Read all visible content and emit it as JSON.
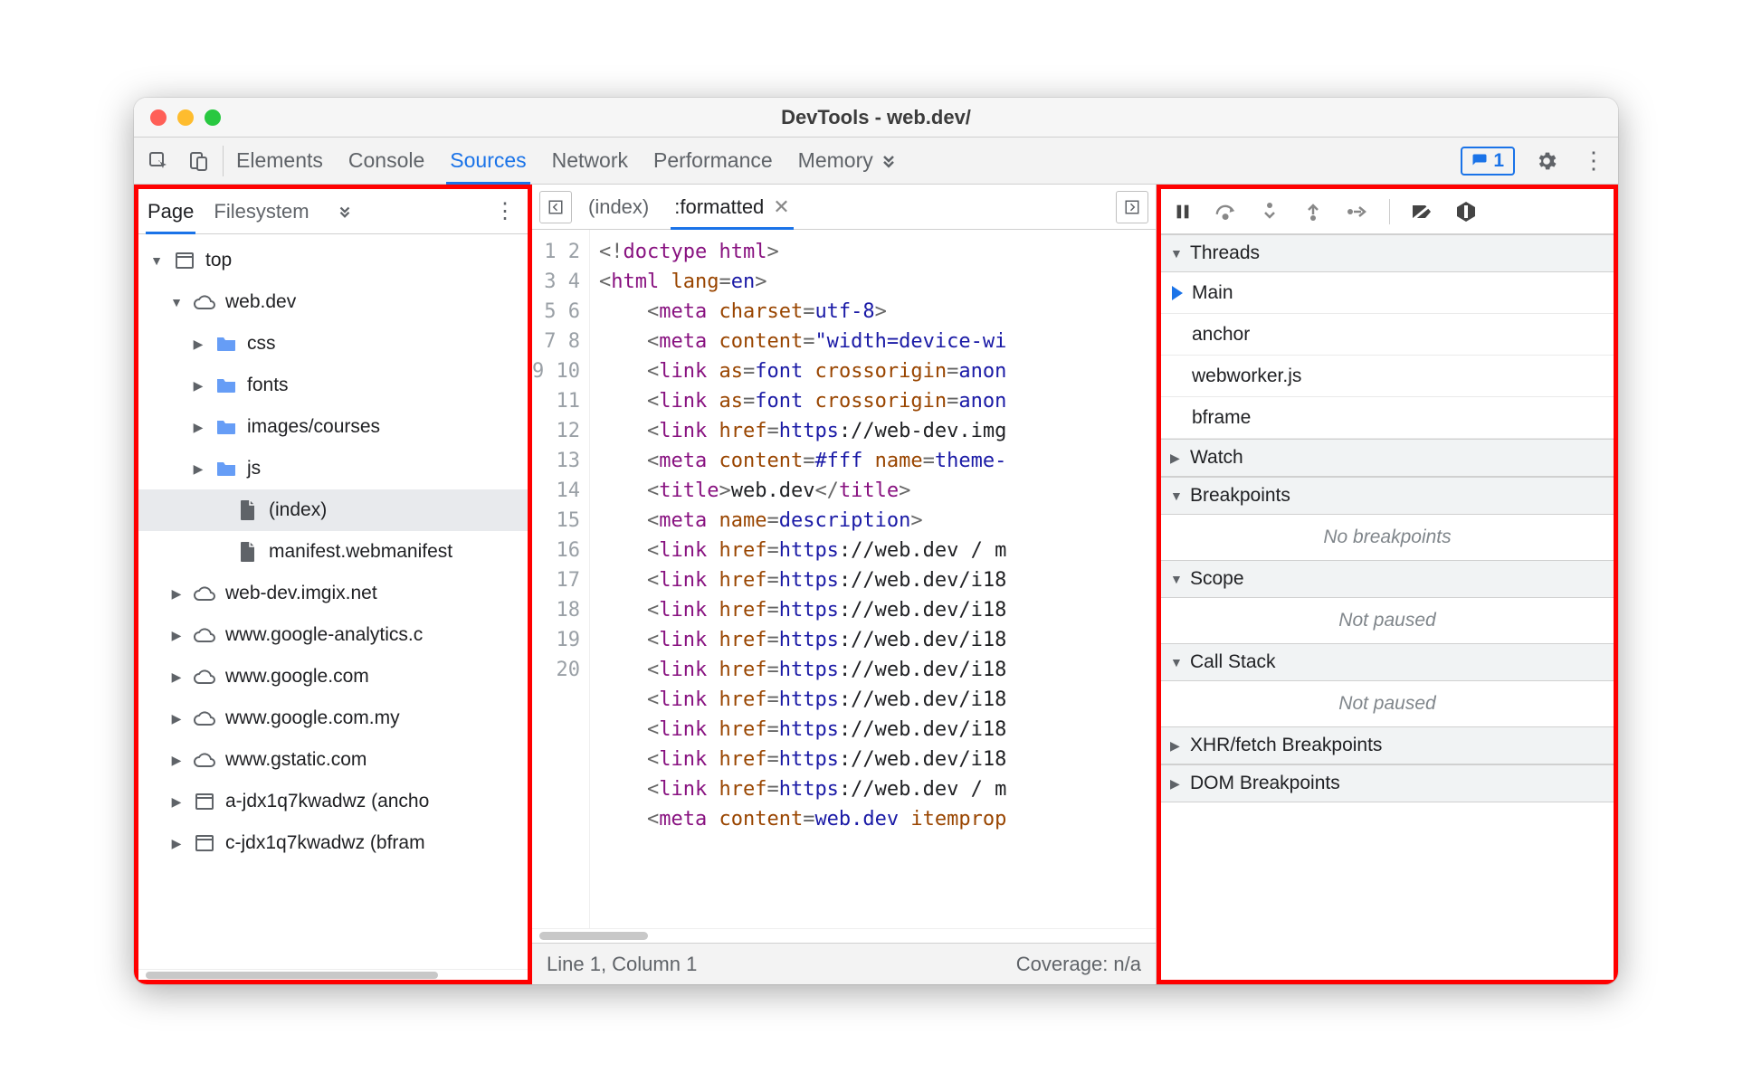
{
  "window_title": "DevTools - web.dev/",
  "toolbar": {
    "tabs": [
      "Elements",
      "Console",
      "Sources",
      "Network",
      "Performance",
      "Memory"
    ],
    "active_tab": "Sources",
    "badge_count": "1"
  },
  "left_pane": {
    "tabs": [
      "Page",
      "Filesystem"
    ],
    "active_tab": "Page",
    "tree": [
      {
        "level": 0,
        "caret": "down",
        "icon": "frame",
        "label": "top"
      },
      {
        "level": 1,
        "caret": "down",
        "icon": "cloud",
        "label": "web.dev"
      },
      {
        "level": 2,
        "caret": "right",
        "icon": "folder",
        "label": "css"
      },
      {
        "level": 2,
        "caret": "right",
        "icon": "folder",
        "label": "fonts"
      },
      {
        "level": 2,
        "caret": "right",
        "icon": "folder",
        "label": "images/courses"
      },
      {
        "level": 2,
        "caret": "right",
        "icon": "folder",
        "label": "js"
      },
      {
        "level": 3,
        "caret": "",
        "icon": "file",
        "label": "(index)",
        "selected": true
      },
      {
        "level": 3,
        "caret": "",
        "icon": "file",
        "label": "manifest.webmanifest"
      },
      {
        "level": 1,
        "caret": "right",
        "icon": "cloud",
        "label": "web-dev.imgix.net"
      },
      {
        "level": 1,
        "caret": "right",
        "icon": "cloud",
        "label": "www.google-analytics.c"
      },
      {
        "level": 1,
        "caret": "right",
        "icon": "cloud",
        "label": "www.google.com"
      },
      {
        "level": 1,
        "caret": "right",
        "icon": "cloud",
        "label": "www.google.com.my"
      },
      {
        "level": 1,
        "caret": "right",
        "icon": "cloud",
        "label": "www.gstatic.com"
      },
      {
        "level": 1,
        "caret": "right",
        "icon": "frame",
        "label": "a-jdx1q7kwadwz (ancho"
      },
      {
        "level": 1,
        "caret": "right",
        "icon": "frame",
        "label": "c-jdx1q7kwadwz (bfram"
      }
    ]
  },
  "editor": {
    "tabs": [
      {
        "label": "(index)",
        "active": false,
        "closable": false
      },
      {
        "label": ":formatted",
        "active": true,
        "closable": true
      }
    ],
    "lines": [
      [
        [
          "punct",
          "<!"
        ],
        [
          "tag",
          "doctype html"
        ],
        [
          "punct",
          ">"
        ]
      ],
      [
        [
          "punct",
          "<"
        ],
        [
          "tag",
          "html "
        ],
        [
          "attr",
          "lang"
        ],
        [
          "punct",
          "="
        ],
        [
          "str",
          "en"
        ],
        [
          "punct",
          ">"
        ]
      ],
      [
        [
          "txt",
          "    "
        ],
        [
          "punct",
          "<"
        ],
        [
          "tag",
          "meta "
        ],
        [
          "attr",
          "charset"
        ],
        [
          "punct",
          "="
        ],
        [
          "str",
          "utf-8"
        ],
        [
          "punct",
          ">"
        ]
      ],
      [
        [
          "txt",
          "    "
        ],
        [
          "punct",
          "<"
        ],
        [
          "tag",
          "meta "
        ],
        [
          "attr",
          "content"
        ],
        [
          "punct",
          "="
        ],
        [
          "str",
          "\"width=device-wi"
        ]
      ],
      [
        [
          "txt",
          "    "
        ],
        [
          "punct",
          "<"
        ],
        [
          "tag",
          "link "
        ],
        [
          "attr",
          "as"
        ],
        [
          "punct",
          "="
        ],
        [
          "str",
          "font "
        ],
        [
          "attr",
          "crossorigin"
        ],
        [
          "punct",
          "="
        ],
        [
          "str",
          "anon"
        ]
      ],
      [
        [
          "txt",
          "    "
        ],
        [
          "punct",
          "<"
        ],
        [
          "tag",
          "link "
        ],
        [
          "attr",
          "as"
        ],
        [
          "punct",
          "="
        ],
        [
          "str",
          "font "
        ],
        [
          "attr",
          "crossorigin"
        ],
        [
          "punct",
          "="
        ],
        [
          "str",
          "anon"
        ]
      ],
      [
        [
          "txt",
          "    "
        ],
        [
          "punct",
          "<"
        ],
        [
          "tag",
          "link "
        ],
        [
          "attr",
          "href"
        ],
        [
          "punct",
          "="
        ],
        [
          "str",
          "https"
        ],
        [
          "txt",
          "://web-dev.img"
        ]
      ],
      [
        [
          "txt",
          "    "
        ],
        [
          "punct",
          "<"
        ],
        [
          "tag",
          "meta "
        ],
        [
          "attr",
          "content"
        ],
        [
          "punct",
          "="
        ],
        [
          "str",
          "#fff "
        ],
        [
          "attr",
          "name"
        ],
        [
          "punct",
          "="
        ],
        [
          "str",
          "theme-"
        ]
      ],
      [
        [
          "txt",
          "    "
        ],
        [
          "punct",
          "<"
        ],
        [
          "tag",
          "title"
        ],
        [
          "punct",
          ">"
        ],
        [
          "txt",
          "web.dev"
        ],
        [
          "punct",
          "</"
        ],
        [
          "tag",
          "title"
        ],
        [
          "punct",
          ">"
        ]
      ],
      [
        [
          "txt",
          "    "
        ],
        [
          "punct",
          "<"
        ],
        [
          "tag",
          "meta "
        ],
        [
          "attr",
          "name"
        ],
        [
          "punct",
          "="
        ],
        [
          "str",
          "description"
        ],
        [
          "punct",
          ">"
        ]
      ],
      [
        [
          "txt",
          "    "
        ],
        [
          "punct",
          "<"
        ],
        [
          "tag",
          "link "
        ],
        [
          "attr",
          "href"
        ],
        [
          "punct",
          "="
        ],
        [
          "str",
          "https"
        ],
        [
          "txt",
          "://web.dev / m"
        ]
      ],
      [
        [
          "txt",
          "    "
        ],
        [
          "punct",
          "<"
        ],
        [
          "tag",
          "link "
        ],
        [
          "attr",
          "href"
        ],
        [
          "punct",
          "="
        ],
        [
          "str",
          "https"
        ],
        [
          "txt",
          "://web.dev/i18"
        ]
      ],
      [
        [
          "txt",
          "    "
        ],
        [
          "punct",
          "<"
        ],
        [
          "tag",
          "link "
        ],
        [
          "attr",
          "href"
        ],
        [
          "punct",
          "="
        ],
        [
          "str",
          "https"
        ],
        [
          "txt",
          "://web.dev/i18"
        ]
      ],
      [
        [
          "txt",
          "    "
        ],
        [
          "punct",
          "<"
        ],
        [
          "tag",
          "link "
        ],
        [
          "attr",
          "href"
        ],
        [
          "punct",
          "="
        ],
        [
          "str",
          "https"
        ],
        [
          "txt",
          "://web.dev/i18"
        ]
      ],
      [
        [
          "txt",
          "    "
        ],
        [
          "punct",
          "<"
        ],
        [
          "tag",
          "link "
        ],
        [
          "attr",
          "href"
        ],
        [
          "punct",
          "="
        ],
        [
          "str",
          "https"
        ],
        [
          "txt",
          "://web.dev/i18"
        ]
      ],
      [
        [
          "txt",
          "    "
        ],
        [
          "punct",
          "<"
        ],
        [
          "tag",
          "link "
        ],
        [
          "attr",
          "href"
        ],
        [
          "punct",
          "="
        ],
        [
          "str",
          "https"
        ],
        [
          "txt",
          "://web.dev/i18"
        ]
      ],
      [
        [
          "txt",
          "    "
        ],
        [
          "punct",
          "<"
        ],
        [
          "tag",
          "link "
        ],
        [
          "attr",
          "href"
        ],
        [
          "punct",
          "="
        ],
        [
          "str",
          "https"
        ],
        [
          "txt",
          "://web.dev/i18"
        ]
      ],
      [
        [
          "txt",
          "    "
        ],
        [
          "punct",
          "<"
        ],
        [
          "tag",
          "link "
        ],
        [
          "attr",
          "href"
        ],
        [
          "punct",
          "="
        ],
        [
          "str",
          "https"
        ],
        [
          "txt",
          "://web.dev/i18"
        ]
      ],
      [
        [
          "txt",
          "    "
        ],
        [
          "punct",
          "<"
        ],
        [
          "tag",
          "link "
        ],
        [
          "attr",
          "href"
        ],
        [
          "punct",
          "="
        ],
        [
          "str",
          "https"
        ],
        [
          "txt",
          "://web.dev / m"
        ]
      ],
      [
        [
          "txt",
          "    "
        ],
        [
          "punct",
          "<"
        ],
        [
          "tag",
          "meta "
        ],
        [
          "attr",
          "content"
        ],
        [
          "punct",
          "="
        ],
        [
          "str",
          "web.dev "
        ],
        [
          "attr",
          "itemprop"
        ]
      ]
    ],
    "status_left": "Line 1, Column 1",
    "status_right": "Coverage: n/a"
  },
  "debugger": {
    "threads_label": "Threads",
    "threads": [
      {
        "label": "Main",
        "current": true
      },
      {
        "label": "anchor"
      },
      {
        "label": "webworker.js"
      },
      {
        "label": "bframe"
      }
    ],
    "sections": [
      {
        "label": "Watch",
        "caret": "right",
        "body": null
      },
      {
        "label": "Breakpoints",
        "caret": "down",
        "body": "No breakpoints"
      },
      {
        "label": "Scope",
        "caret": "down",
        "body": "Not paused"
      },
      {
        "label": "Call Stack",
        "caret": "down",
        "body": "Not paused"
      },
      {
        "label": "XHR/fetch Breakpoints",
        "caret": "right",
        "body": null
      },
      {
        "label": "DOM Breakpoints",
        "caret": "right",
        "body": null
      }
    ]
  }
}
